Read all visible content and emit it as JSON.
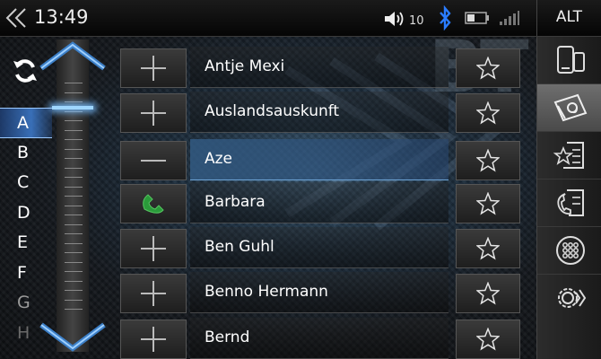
{
  "status_bar": {
    "time": "13:49",
    "volume_level": "10",
    "alt_label": "ALT"
  },
  "watermark_text": "BT",
  "alphabet": {
    "letters": [
      "A",
      "B",
      "C",
      "D",
      "E",
      "F",
      "G",
      "H"
    ],
    "active_letter": "A"
  },
  "contacts": [
    {
      "name": "Antje Mexi",
      "action": "add",
      "selected": false
    },
    {
      "name": "Auslandsauskunft",
      "action": "add",
      "selected": false
    },
    {
      "name": "Aze",
      "action": "remove",
      "selected": true
    },
    {
      "name": "Barbara",
      "action": "call",
      "selected": false
    },
    {
      "name": "Ben Guhl",
      "action": "add",
      "selected": false
    },
    {
      "name": "Benno Hermann",
      "action": "add",
      "selected": false
    },
    {
      "name": "Bernd",
      "action": "add",
      "selected": false
    }
  ],
  "right_toolbar": {
    "buttons": [
      "phone-device-icon",
      "contacts-book-icon",
      "favorites-list-icon",
      "call-history-icon",
      "keypad-icon",
      "settings-gear-icon"
    ],
    "active_button": "contacts-book-icon"
  },
  "colors": {
    "accent": "#6fb6ff",
    "bluetooth": "#2a7cff",
    "call_green": "#2a9a3a"
  }
}
